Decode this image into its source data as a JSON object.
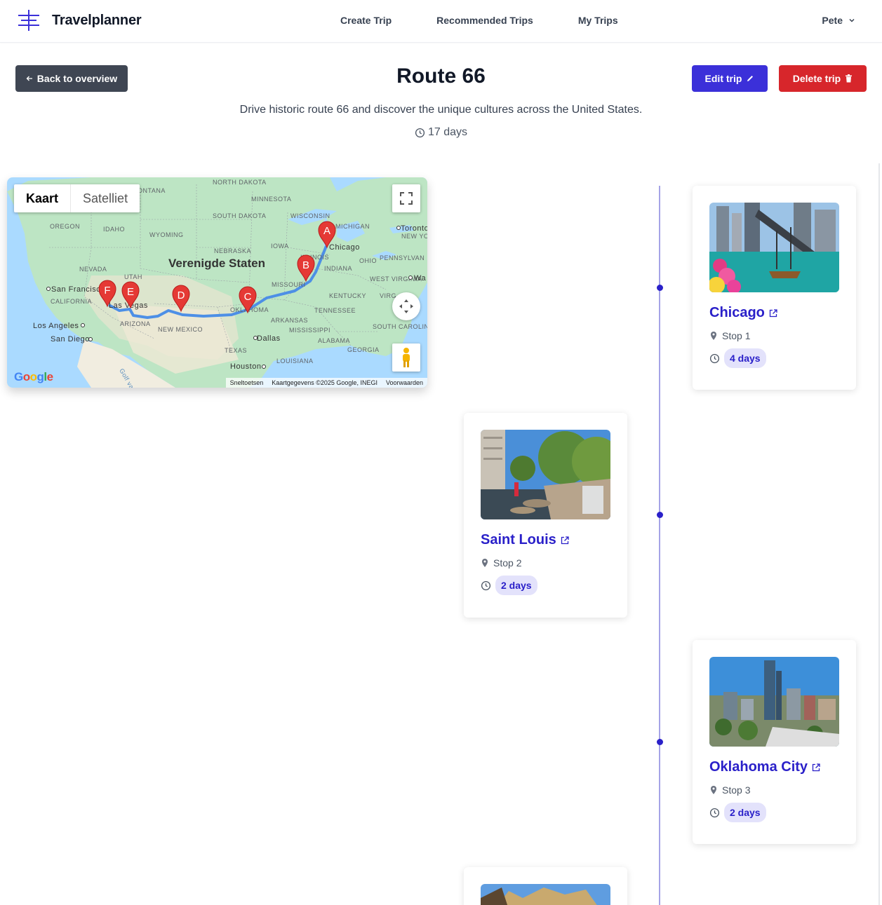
{
  "brand": {
    "name": "Travelplanner",
    "icon": "travelplanner-logo-icon"
  },
  "nav": {
    "links": [
      "Create Trip",
      "Recommended Trips",
      "My Trips"
    ],
    "user": "Pete"
  },
  "header": {
    "back_label": "Back to overview",
    "title": "Route 66",
    "description": "Drive historic route 66 and discover the unique cultures across the United States.",
    "duration": "17 days",
    "edit_label": "Edit trip",
    "delete_label": "Delete trip"
  },
  "map": {
    "type_map": "Kaart",
    "type_satellite": "Satelliet",
    "labels": {
      "north_dakota": "NORTH DAKOTA",
      "montana": "MONTANA",
      "minnesota": "MINNESOTA",
      "oregon": "OREGON",
      "idaho": "IDAHO",
      "south_dakota": "SOUTH DAKOTA",
      "wisconsin": "WISCONSIN",
      "michigan": "MICHIGAN",
      "toronto": "Toronto",
      "new_york": "NEW YOR",
      "wyoming": "WYOMING",
      "iowa": "IOWA",
      "chicago": "Chicago",
      "nebraska": "NEBRASKA",
      "illinois": "ILLINOIS",
      "ohio": "OHIO",
      "pennsylvania": "PENNSYLVAN",
      "nevada": "NEVADA",
      "utah": "UTAH",
      "country": "Verenigde Staten",
      "indiana": "INDIANA",
      "san_francisco": "San Francisco",
      "missouri": "MISSOURI",
      "west_virginia": "WEST VIRGINIA",
      "washington": "Wa",
      "california": "CALIFORNIA",
      "las_vegas": "Las Vegas",
      "kentucky": "KENTUCKY",
      "virginia": "VIRG",
      "oklahoma": "OKLAHOMA",
      "tennessee": "TENNESSEE",
      "arizona": "ARIZONA",
      "new_mexico": "NEW MEXICO",
      "arkansas": "ARKANSAS",
      "los_angeles": "Los Angeles",
      "mississippi": "MISSISSIPPI",
      "south_carolina": "SOUTH CAROLINA",
      "san_diego": "San Diego",
      "dallas": "Dallas",
      "alabama": "ALABAMA",
      "texas": "TEXAS",
      "georgia": "GEORGIA",
      "houston": "Houston",
      "louisiana": "LOUISIANA",
      "gulf": "Golf van"
    },
    "markers": [
      "A",
      "B",
      "C",
      "D",
      "E",
      "F"
    ],
    "footer": {
      "shortcuts": "Sneltoetsen",
      "data": "Kaartgegevens ©2025 Google, INEGI",
      "terms": "Voorwaarden"
    },
    "google": "Google",
    "google_colors": [
      "#4285F4",
      "#EA4335",
      "#FBBC05",
      "#4285F4",
      "#34A853",
      "#EA4335"
    ]
  },
  "stops": [
    {
      "name": "Chicago",
      "stop": "Stop 1",
      "days": "4 days"
    },
    {
      "name": "Saint Louis",
      "stop": "Stop 2",
      "days": "2 days"
    },
    {
      "name": "Oklahoma City",
      "stop": "Stop 3",
      "days": "2 days"
    }
  ],
  "colors": {
    "primary": "#3b30d9",
    "danger": "#d7262b",
    "dark": "#3f4653",
    "link": "#2a20c9",
    "badge_bg": "#e3e2fb"
  }
}
